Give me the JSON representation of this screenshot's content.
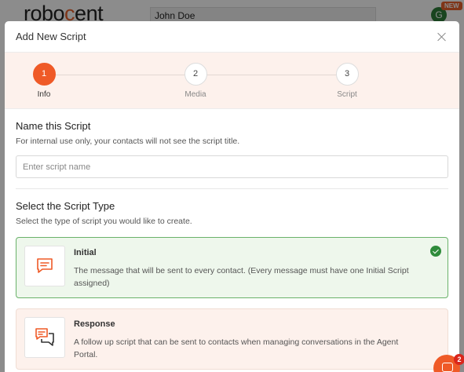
{
  "background": {
    "logo_text_start": "robo",
    "logo_text_accent": "c",
    "logo_text_end": "ent",
    "user_name": "John Doe",
    "avatar_initial": "G",
    "new_badge": "NEW"
  },
  "modal": {
    "title": "Add New Script"
  },
  "stepper": {
    "steps": [
      {
        "number": "1",
        "label": "Info",
        "active": true
      },
      {
        "number": "2",
        "label": "Media",
        "active": false
      },
      {
        "number": "3",
        "label": "Script",
        "active": false
      }
    ]
  },
  "name_section": {
    "title": "Name this Script",
    "description": "For internal use only, your contacts will not see the script title.",
    "placeholder": "Enter script name",
    "value": ""
  },
  "type_section": {
    "title": "Select the Script Type",
    "description": "Select the type of script you would like to create.",
    "options": [
      {
        "title": "Initial",
        "description": "The message that will be sent to every contact. (Every message must have one Initial Script assigned)",
        "icon": "chat-single-icon",
        "selected": true
      },
      {
        "title": "Response",
        "description": "A follow up script that can be sent to contacts when managing conversations in the Agent Portal.",
        "icon": "chat-double-icon",
        "selected": false
      }
    ]
  },
  "chat_widget": {
    "badge_count": "2"
  },
  "colors": {
    "accent": "#ef5a27",
    "selected_border": "#6ab26a",
    "check": "#2e8b3a"
  }
}
